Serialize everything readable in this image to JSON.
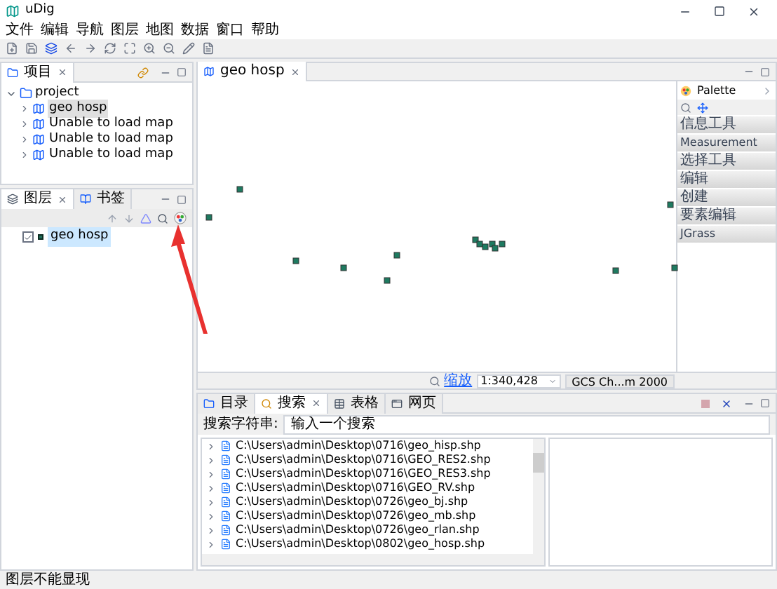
{
  "window": {
    "title": "uDig"
  },
  "menu": [
    "文件",
    "编辑",
    "导航",
    "图层",
    "地图",
    "数据",
    "窗口",
    "帮助"
  ],
  "project_panel": {
    "tabs": [
      {
        "label": "项目",
        "selected": true
      }
    ],
    "tree": {
      "label": "project",
      "expanded": true,
      "children": [
        {
          "label": "geo hosp",
          "selected": true
        },
        {
          "label": "Unable to load map",
          "selected": false
        },
        {
          "label": "Unable to load map",
          "selected": false
        },
        {
          "label": "Unable to load map",
          "selected": false
        }
      ]
    }
  },
  "layers_panel": {
    "tabs": [
      {
        "label": "图层",
        "selected": true
      },
      {
        "label": "书签",
        "selected": false
      }
    ],
    "layers": [
      {
        "label": "geo hosp",
        "checked": true,
        "selected": true
      }
    ]
  },
  "editor": {
    "tabs": [
      {
        "label": "geo hosp",
        "selected": true
      }
    ],
    "zoom_link": "缩放",
    "scale": "1:340,428",
    "crs": "GCS Ch...m 2000"
  },
  "palette": {
    "title": "Palette",
    "groups": [
      "信息工具",
      "Measurement",
      "选择工具",
      "编辑",
      "创建",
      "要素编辑",
      "JGrass"
    ]
  },
  "bottom_panel": {
    "tabs": [
      {
        "label": "目录",
        "selected": false
      },
      {
        "label": "搜索",
        "selected": true
      },
      {
        "label": "表格",
        "selected": false
      },
      {
        "label": "网页",
        "selected": false
      }
    ],
    "search_label": "搜索字符串:",
    "search_placeholder": "输入一个搜索",
    "results": [
      {
        "label": "C:\\Users\\admin\\Desktop\\0716\\geo_hisp.shp",
        "expanded": false
      },
      {
        "label": "C:\\Users\\admin\\Desktop\\0716\\GEO_RES2.shp",
        "expanded": false
      },
      {
        "label": "C:\\Users\\admin\\Desktop\\0716\\GEO_RES3.shp",
        "expanded": false
      },
      {
        "label": "C:\\Users\\admin\\Desktop\\0716\\GEO_RV.shp",
        "expanded": false
      },
      {
        "label": "C:\\Users\\admin\\Desktop\\0726\\geo_bj.shp",
        "expanded": false
      },
      {
        "label": "C:\\Users\\admin\\Desktop\\0726\\geo_mb.shp",
        "expanded": false
      },
      {
        "label": "C:\\Users\\admin\\Desktop\\0726\\geo_rlan.shp",
        "expanded": false
      },
      {
        "label": "C:\\Users\\admin\\Desktop\\0802\\geo_hosp.shp",
        "expanded": false
      }
    ]
  },
  "status_bar": {
    "text": "图层不能显现"
  }
}
